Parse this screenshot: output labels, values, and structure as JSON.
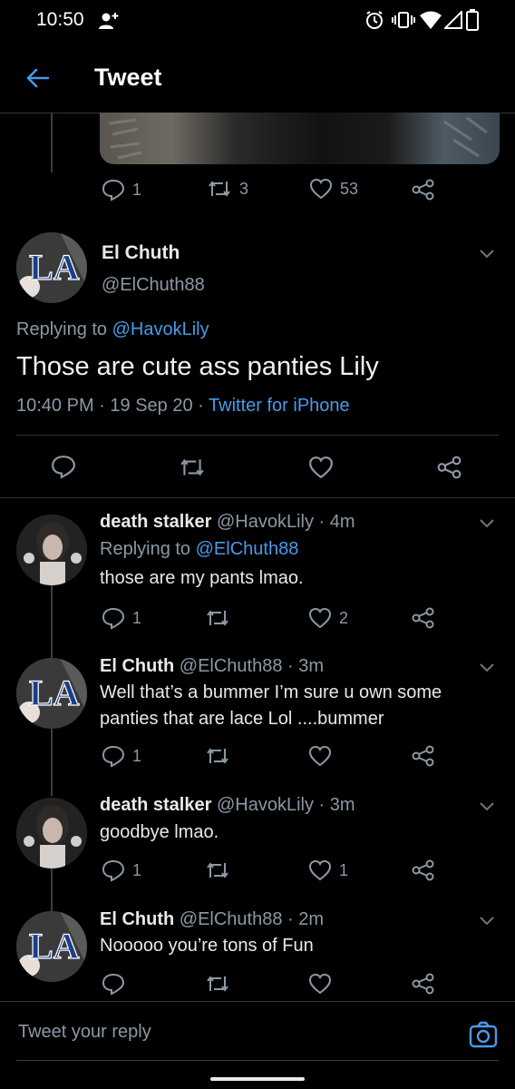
{
  "status_bar": {
    "time": "10:50"
  },
  "header": {
    "title": "Tweet"
  },
  "prev_tweet": {
    "reply_count": "1",
    "retweet_count": "3",
    "like_count": "53"
  },
  "main_tweet": {
    "display_name": "El Chuth",
    "handle": "@ElChuth88",
    "replying_prefix": "Replying to",
    "replying_to": "@HavokLily",
    "text": "Those are cute ass panties Lily",
    "time": "10:40 PM",
    "sep1": "·",
    "date": "19 Sep 20",
    "sep2": "·",
    "source": "Twitter for iPhone"
  },
  "replies": [
    {
      "display_name": "death stalker",
      "meta": "@HavokLily · 4m",
      "replying_prefix": "Replying to",
      "replying_to": "@ElChuth88",
      "text": "those are my pants lmao.",
      "reply_count": "1",
      "retweet_count": "",
      "like_count": "2"
    },
    {
      "display_name": "El Chuth",
      "meta": "@ElChuth88 · 3m",
      "text_line1": "Well that’s a bummer I’m sure u own some",
      "text_line2": "panties that are lace Lol ....bummer",
      "reply_count": "1",
      "retweet_count": "",
      "like_count": ""
    },
    {
      "display_name": "death stalker",
      "meta": "@HavokLily · 3m",
      "text": "goodbye lmao.",
      "reply_count": "1",
      "retweet_count": "",
      "like_count": "1"
    },
    {
      "display_name": "El Chuth",
      "meta": "@ElChuth88 · 2m",
      "text": "Nooooo you’re tons of Fun",
      "reply_count": "",
      "retweet_count": "",
      "like_count": ""
    }
  ],
  "composer": {
    "placeholder": "Tweet your reply"
  },
  "icons": {
    "back": "arrow-left-icon",
    "reply": "reply-icon",
    "retweet": "retweet-icon",
    "like": "heart-icon",
    "share": "share-icon",
    "camera": "camera-icon"
  },
  "colors": {
    "accent": "#4a99e9",
    "background": "#000000",
    "muted": "#8b98a5"
  }
}
